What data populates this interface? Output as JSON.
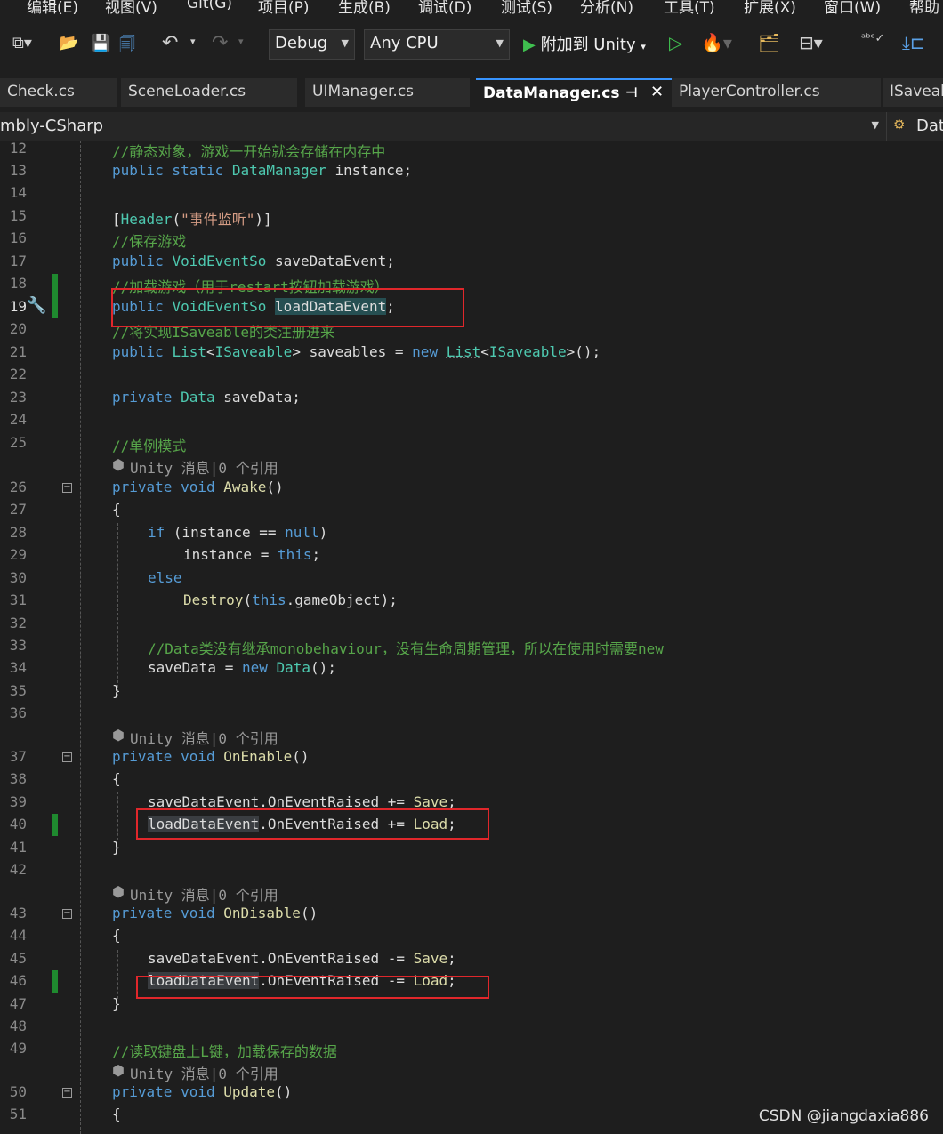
{
  "menu": [
    "编辑(E)",
    "视图(V)",
    "Git(G)",
    "项目(P)",
    "生成(B)",
    "调试(D)",
    "测试(S)",
    "分析(N)",
    "工具(T)",
    "扩展(X)",
    "窗口(W)",
    "帮助"
  ],
  "toolbar": {
    "config": "Debug",
    "platform": "Any CPU",
    "attach_label": "附加到 Unity"
  },
  "tabs": [
    "Check.cs",
    "SceneLoader.cs",
    "UIManager.cs",
    "DataManager.cs",
    "PlayerController.cs",
    "ISaveab"
  ],
  "active_tab": "DataManager.cs",
  "navbar": {
    "project": "mbly-CSharp",
    "member": "Dat"
  },
  "hint_text": "Unity 消息|0 个引用",
  "lines": {
    "l12": "//静态对象，游戏一开始就会存储在内存中",
    "l16": "//保存游戏",
    "l18": "//加载游戏（用于restart按钮加载游戏）",
    "l20": "//将实现ISaveable的类注册进来",
    "l25": "//单例模式",
    "l33": "//Data类没有继承monobehaviour，没有生命周期管理，所以在使用时需要new",
    "l49": "//读取键盘上L键，加载保存的数据"
  },
  "watermark": "CSDN @jiangdaxia886"
}
